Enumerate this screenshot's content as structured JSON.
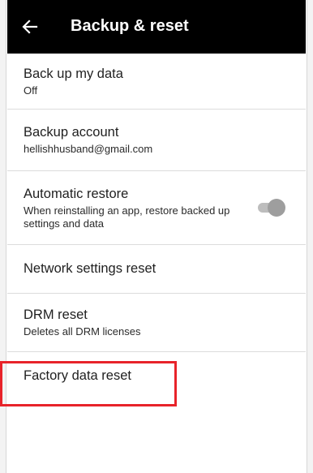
{
  "appbar": {
    "title": "Backup & reset",
    "back_icon": "arrow-back-icon"
  },
  "items": [
    {
      "title": "Back up my data",
      "summary": "Off"
    },
    {
      "title": "Backup account",
      "summary": "hellishhusband@gmail.com"
    },
    {
      "title": "Automatic restore",
      "summary": "When reinstalling an app, restore backed up settings and data",
      "toggle_on": true
    },
    {
      "title": "Network settings reset"
    },
    {
      "title": "DRM reset",
      "summary": "Deletes all DRM licenses"
    },
    {
      "title": "Factory data reset"
    }
  ],
  "colors": {
    "appbar_bg": "#000000",
    "highlight": "#e8232a",
    "divider": "#dcdcdc"
  }
}
